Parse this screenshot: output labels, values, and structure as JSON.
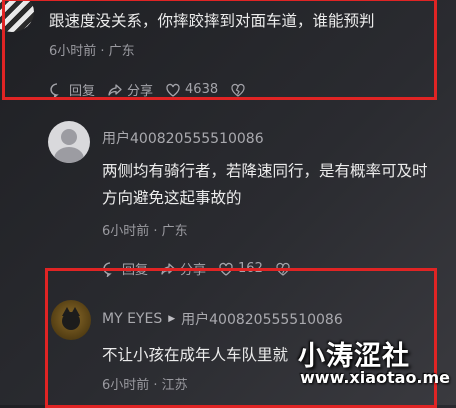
{
  "comments": [
    {
      "text": "跟速度没关系，你摔跤摔到对面车道，谁能预判",
      "meta": "6小时前 · 广东",
      "actions": {
        "reply": "回复",
        "share": "分享",
        "likes": "4638"
      }
    },
    {
      "user": "用户400820555510086",
      "text_line1": "两侧均有骑行者，若降速同行，是有概率可及时",
      "text_line2": "方向避免这起事故的",
      "meta": "6小时前 · 广东",
      "actions": {
        "reply": "回复",
        "share": "分享",
        "likes": "162"
      }
    },
    {
      "user": "MY EYES",
      "reply_to": "用户400820555510086",
      "text": "不让小孩在成年人车队里就",
      "meta": "6小时前 · 江苏"
    }
  ],
  "watermark": {
    "name": "小涛涩社",
    "url": "www.xiaotao.me"
  },
  "colors": {
    "highlight_border": "#e02424",
    "background": "#2a2b30"
  }
}
